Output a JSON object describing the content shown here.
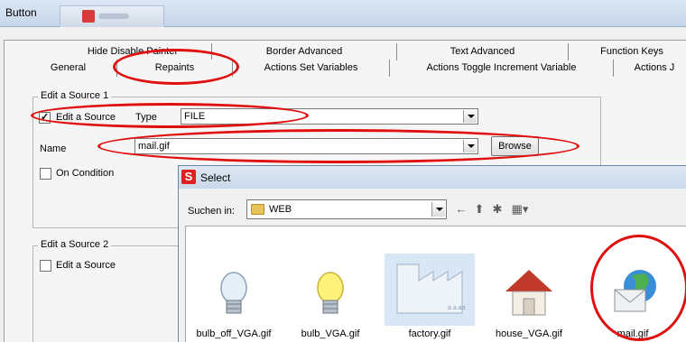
{
  "window": {
    "title": "Button"
  },
  "tabs": {
    "row1": [
      "Hide Disable Painter",
      "Border Advanced",
      "Text Advanced",
      "Function Keys"
    ],
    "row2": [
      "General",
      "Repaints",
      "Actions Set Variables",
      "Actions Toggle Increment Variable",
      "Actions J"
    ]
  },
  "source1": {
    "title": "Edit a Source 1",
    "edit_label": "Edit a Source",
    "edit_checked": true,
    "type_label": "Type",
    "type_value": "FILE",
    "name_label": "Name",
    "name_value": "mail.gif",
    "browse_label": "Browse",
    "condition_label": "On Condition"
  },
  "source2": {
    "title": "Edit a Source 2",
    "edit_label": "Edit a Source"
  },
  "dialog": {
    "title": "Select",
    "logo": "S",
    "look_in_label": "Suchen in:",
    "folder": "WEB",
    "files": [
      {
        "name": "bulb_off_VGA.gif",
        "icon": "bulb-off-icon"
      },
      {
        "name": "bulb_VGA.gif",
        "icon": "bulb-on-icon"
      },
      {
        "name": "factory.gif",
        "icon": "factory-icon"
      },
      {
        "name": "house_VGA.gif",
        "icon": "house-icon"
      },
      {
        "name": "mail.gif",
        "icon": "mail-icon"
      }
    ]
  },
  "colors": {
    "annotation": "#e01010",
    "title_bar": "#c9d8eb",
    "selected_file": "#d8e6f5"
  }
}
